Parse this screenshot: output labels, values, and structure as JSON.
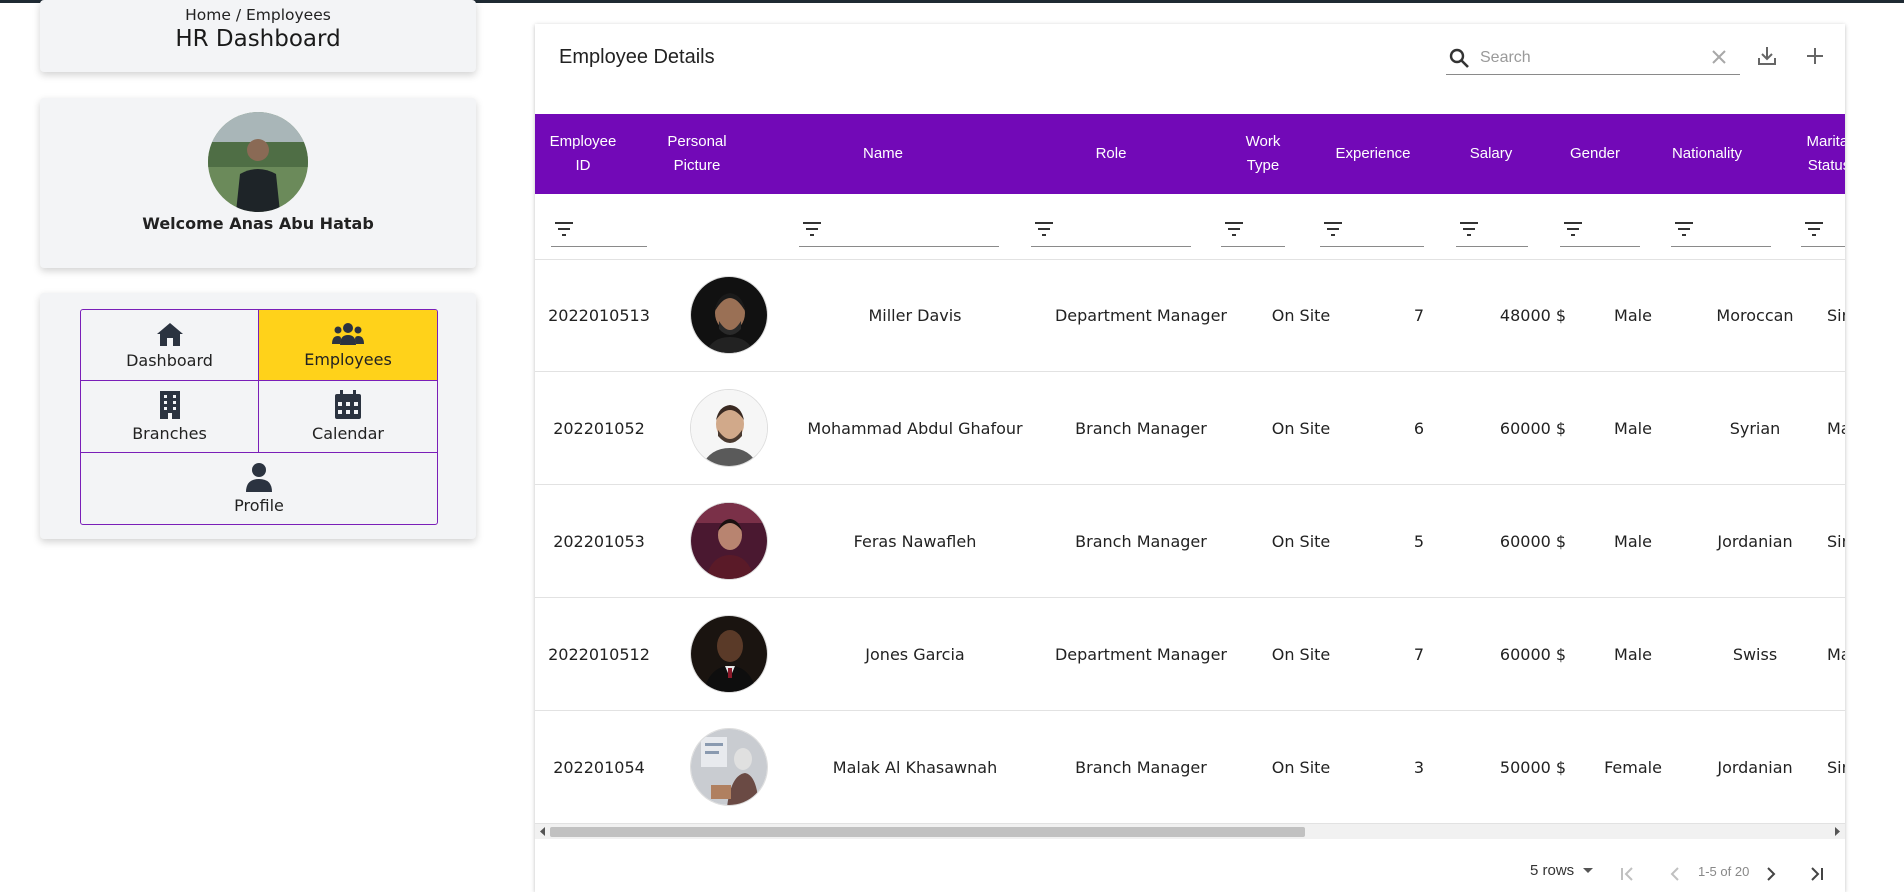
{
  "header": {
    "breadcrumb": "Home / Employees",
    "title": "HR Dashboard"
  },
  "user": {
    "welcome": "Welcome Anas Abu Hatab"
  },
  "nav": {
    "items": [
      {
        "label": "Dashboard",
        "icon": "home-icon",
        "active": false
      },
      {
        "label": "Employees",
        "icon": "users-icon",
        "active": true
      },
      {
        "label": "Branches",
        "icon": "building-icon",
        "active": false
      },
      {
        "label": "Calendar",
        "icon": "calendar-icon",
        "active": false
      },
      {
        "label": "Profile",
        "icon": "user-icon",
        "active": false
      }
    ],
    "active_color": "#ffd21a",
    "border_color": "#7a1fb8"
  },
  "table": {
    "title": "Employee Details",
    "search_placeholder": "Search",
    "header_color": "#7209b7",
    "columns": [
      "Employee\nID",
      "Personal\nPicture",
      "Name",
      "Role",
      "Work\nType",
      "Experience",
      "Salary",
      "Gender",
      "Nationality",
      "Marital\nStatus"
    ],
    "rows": [
      {
        "id": "2022010513",
        "name": "Miller Davis",
        "role": "Department Manager",
        "work_type": "On Site",
        "experience": "7",
        "salary": "48000 $",
        "gender": "Male",
        "nationality": "Moroccan",
        "marital": "Single"
      },
      {
        "id": "202201052",
        "name": "Mohammad Abdul Ghafour",
        "role": "Branch Manager",
        "work_type": "On Site",
        "experience": "6",
        "salary": "60000 $",
        "gender": "Male",
        "nationality": "Syrian",
        "marital": "Married"
      },
      {
        "id": "202201053",
        "name": "Feras Nawafleh",
        "role": "Branch Manager",
        "work_type": "On Site",
        "experience": "5",
        "salary": "60000 $",
        "gender": "Male",
        "nationality": "Jordanian",
        "marital": "Single"
      },
      {
        "id": "2022010512",
        "name": "Jones Garcia",
        "role": "Department Manager",
        "work_type": "On Site",
        "experience": "7",
        "salary": "60000 $",
        "gender": "Male",
        "nationality": "Swiss",
        "marital": "Married"
      },
      {
        "id": "202201054",
        "name": "Malak Al Khasawnah",
        "role": "Branch Manager",
        "work_type": "On Site",
        "experience": "3",
        "salary": "50000 $",
        "gender": "Female",
        "nationality": "Jordanian",
        "marital": "Single"
      }
    ]
  },
  "pagination": {
    "rows_per_page": "5 rows",
    "range": "1-5 of 20"
  }
}
